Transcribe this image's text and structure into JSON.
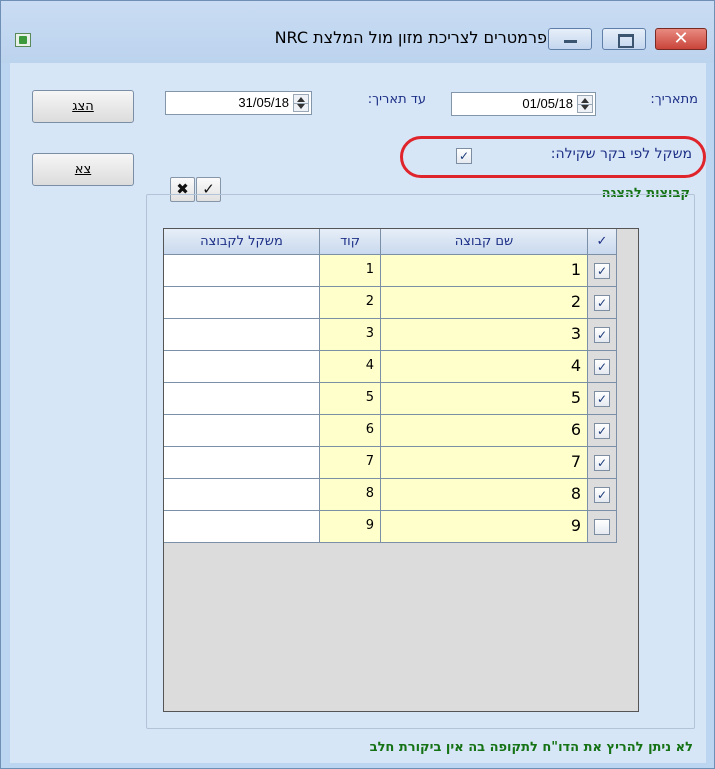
{
  "window": {
    "title": "פרמטרים לצריכת מזון מול המלצת NRC",
    "close_glyph": "✕"
  },
  "buttons": {
    "show_label": "הצג",
    "exit_label": "צא"
  },
  "filters": {
    "from_label": "מתאריך:",
    "from_value": "01/05/18",
    "to_label": "עד תאריך:",
    "to_value": "31/05/18",
    "weigh_label": "משקל לפי בקר שקילה:",
    "weigh_checked": true
  },
  "toolbar": {
    "clear_glyph": "✖",
    "check_glyph": "✓"
  },
  "groups": {
    "title": "קבוצות להצגה",
    "headers": {
      "check": "✓",
      "name": "שם קבוצה",
      "code": "קוד",
      "weight": "משקל לקבוצה"
    },
    "rows": [
      {
        "checked": true,
        "name": "1",
        "code": "1",
        "weight": ""
      },
      {
        "checked": true,
        "name": "2",
        "code": "2",
        "weight": ""
      },
      {
        "checked": true,
        "name": "3",
        "code": "3",
        "weight": ""
      },
      {
        "checked": true,
        "name": "4",
        "code": "4",
        "weight": ""
      },
      {
        "checked": true,
        "name": "5",
        "code": "5",
        "weight": ""
      },
      {
        "checked": true,
        "name": "6",
        "code": "6",
        "weight": ""
      },
      {
        "checked": true,
        "name": "7",
        "code": "7",
        "weight": ""
      },
      {
        "checked": true,
        "name": "8",
        "code": "8",
        "weight": ""
      },
      {
        "checked": false,
        "name": "9",
        "code": "9",
        "weight": ""
      }
    ]
  },
  "status": {
    "message": "לא ניתן להריץ את הדו\"ח לתקופה בה אין ביקורת חלב"
  },
  "colors": {
    "label_blue": "#1c2f86",
    "accent_green": "#157315",
    "highlight_red": "#e0242b",
    "cell_yellow": "#ffffcc"
  }
}
